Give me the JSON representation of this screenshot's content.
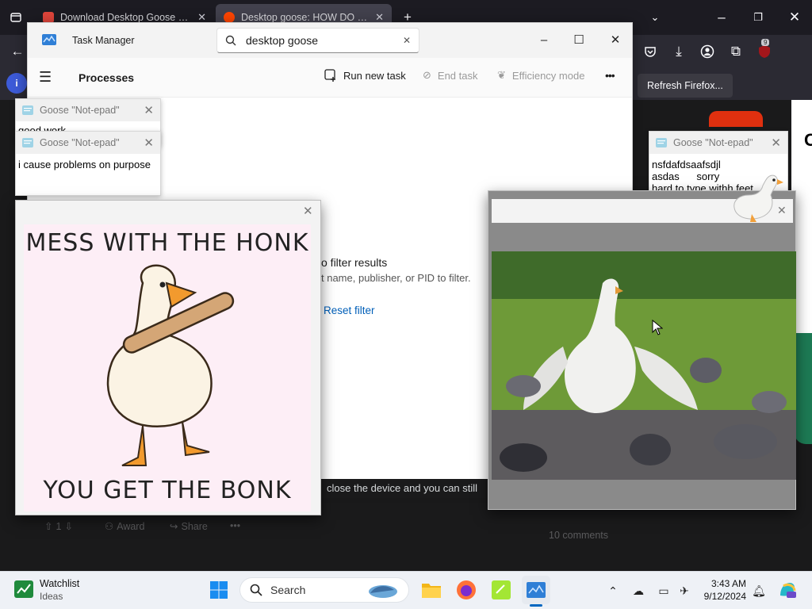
{
  "browser": {
    "tabs": [
      {
        "label": "Download Desktop Goose by sa"
      },
      {
        "label": "Desktop goose: HOW DO I DEL"
      }
    ],
    "extension_badge": "9",
    "refresh_button": "Refresh Firefox...",
    "new_tab": "+"
  },
  "task_manager": {
    "title": "Task Manager",
    "search_value": "desktop goose",
    "page_title": "Processes",
    "run_new_task": "Run new task",
    "end_task": "End task",
    "efficiency_mode": "Efficiency mode",
    "more": "•••",
    "empty_title": "o filter results",
    "empty_hint": "t name, publisher, or PID to filter.",
    "reset_filter": "Reset filter"
  },
  "notes": [
    {
      "title": "Goose \"Not-epad\"",
      "text": "good work"
    },
    {
      "title": "Goose \"Not-epad\"",
      "text": "i cause problems on purpose"
    },
    {
      "title": "Goose \"Not-epad\"",
      "text": "nsfdafdsaafsdjl\nasdas      sorry\nhard to type withh feet"
    }
  ],
  "memes": {
    "top_text": "MESS WITH THE HONK",
    "bottom_text": "YOU GET THE BONK"
  },
  "reddit": {
    "body_fragment": "close the device and you can still",
    "vote_count": "1",
    "award": "Award",
    "share": "Share",
    "more": "•••",
    "comments": "10 comments"
  },
  "taskbar": {
    "widget_title": "Watchlist",
    "widget_subtitle": "Ideas",
    "search_placeholder": "Search",
    "time": "3:43 AM",
    "date": "9/12/2024"
  }
}
